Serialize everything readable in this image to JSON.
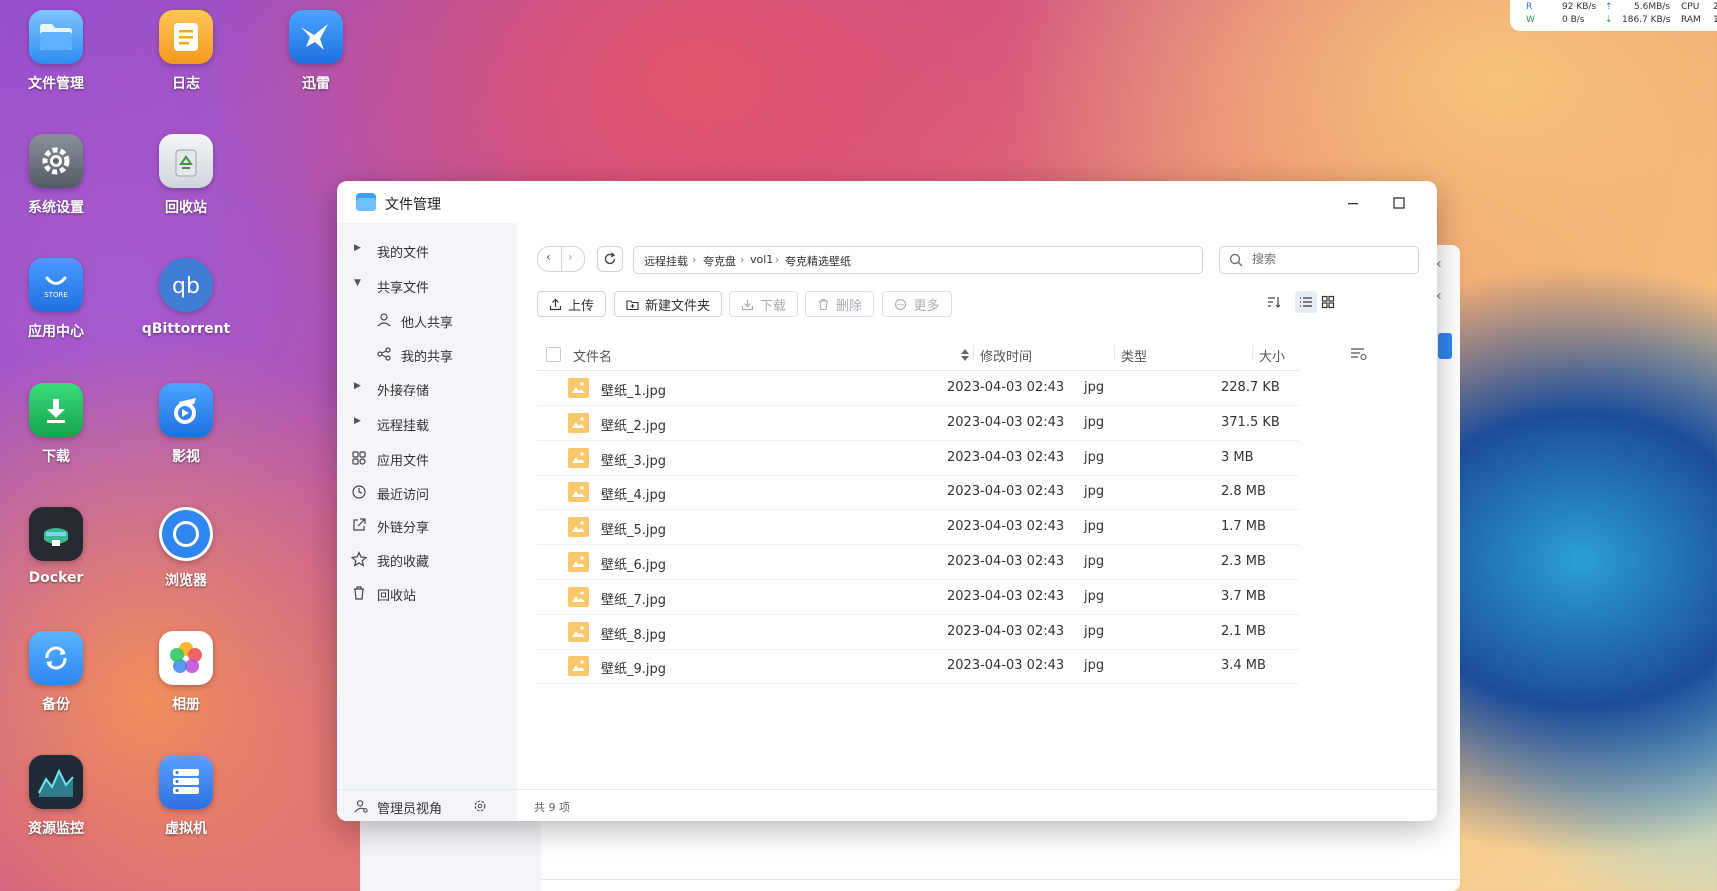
{
  "desktop": {
    "icons": [
      {
        "label": "文件管理",
        "icon": "folder-icon",
        "color": "#3aa0f5"
      },
      {
        "label": "日志",
        "icon": "log-icon",
        "color": "#f5a623"
      },
      {
        "label": "迅雷",
        "icon": "xunlei-bird-icon",
        "color": "#2e8bf0"
      },
      {
        "label": "系统设置",
        "icon": "gear-icon",
        "color": "#6d7580"
      },
      {
        "label": "回收站",
        "icon": "recycle-bin-icon",
        "color": "#dfe3e8"
      },
      {
        "label": "应用中心",
        "icon": "store-icon",
        "color": "#2f86f0"
      },
      {
        "label": "qBittorrent",
        "icon": "qbittorrent-icon",
        "color": "#3f7dd6"
      },
      {
        "label": "下载",
        "icon": "download-icon",
        "color": "#22c55e"
      },
      {
        "label": "影视",
        "icon": "video-icon",
        "color": "#2f86f0"
      },
      {
        "label": "Docker",
        "icon": "docker-icon",
        "color": "#2d2d2d"
      },
      {
        "label": "浏览器",
        "icon": "browser-icon",
        "color": "#2f86f0"
      },
      {
        "label": "备份",
        "icon": "backup-icon",
        "color": "#3aa0f5"
      },
      {
        "label": "相册",
        "icon": "photos-icon",
        "color": "#ffffff"
      },
      {
        "label": "资源监控",
        "icon": "monitor-icon",
        "color": "#1f2a36"
      },
      {
        "label": "虚拟机",
        "icon": "vm-icon",
        "color": "#3f86f0"
      }
    ]
  },
  "netstat": {
    "r_label": "R",
    "r_net": "92 KB/s",
    "r_disk": "5.6MB/s",
    "cpu_label": "CPU",
    "cpu_val": "2",
    "w_label": "W",
    "w_net": "0  B/s",
    "w_disk": "186.7 KB/s",
    "ram_label": "RAM",
    "ram_val": "1"
  },
  "window": {
    "title": "文件管理",
    "sidebar": {
      "items": [
        {
          "label": "我的文件"
        },
        {
          "label": "共享文件"
        },
        {
          "label": "他人共享"
        },
        {
          "label": "我的共享"
        },
        {
          "label": "外接存储"
        },
        {
          "label": "远程挂载"
        },
        {
          "label": "应用文件"
        },
        {
          "label": "最近访问"
        },
        {
          "label": "外链分享"
        },
        {
          "label": "我的收藏"
        },
        {
          "label": "回收站"
        }
      ],
      "admin_label": "管理员视角"
    },
    "breadcrumb": [
      "远程挂载",
      "夸克盘",
      "vol1",
      "夸克精选壁纸"
    ],
    "search_placeholder": "搜索",
    "toolbar": {
      "upload": "上传",
      "new_folder": "新建文件夹",
      "download": "下载",
      "delete": "删除",
      "more": "更多"
    },
    "columns": {
      "name": "文件名",
      "modified": "修改时间",
      "type": "类型",
      "size": "大小"
    },
    "files": [
      {
        "name": "壁纸_1.jpg",
        "modified": "2023-04-03 02:43",
        "type": "jpg",
        "size": "228.7 KB"
      },
      {
        "name": "壁纸_2.jpg",
        "modified": "2023-04-03 02:43",
        "type": "jpg",
        "size": "371.5 KB"
      },
      {
        "name": "壁纸_3.jpg",
        "modified": "2023-04-03 02:43",
        "type": "jpg",
        "size": "3 MB"
      },
      {
        "name": "壁纸_4.jpg",
        "modified": "2023-04-03 02:43",
        "type": "jpg",
        "size": "2.8 MB"
      },
      {
        "name": "壁纸_5.jpg",
        "modified": "2023-04-03 02:43",
        "type": "jpg",
        "size": "1.7 MB"
      },
      {
        "name": "壁纸_6.jpg",
        "modified": "2023-04-03 02:43",
        "type": "jpg",
        "size": "2.3 MB"
      },
      {
        "name": "壁纸_7.jpg",
        "modified": "2023-04-03 02:43",
        "type": "jpg",
        "size": "3.7 MB"
      },
      {
        "name": "壁纸_8.jpg",
        "modified": "2023-04-03 02:43",
        "type": "jpg",
        "size": "2.1 MB"
      },
      {
        "name": "壁纸_9.jpg",
        "modified": "2023-04-03 02:43",
        "type": "jpg",
        "size": "3.4 MB"
      }
    ],
    "status": "共 9 项"
  }
}
